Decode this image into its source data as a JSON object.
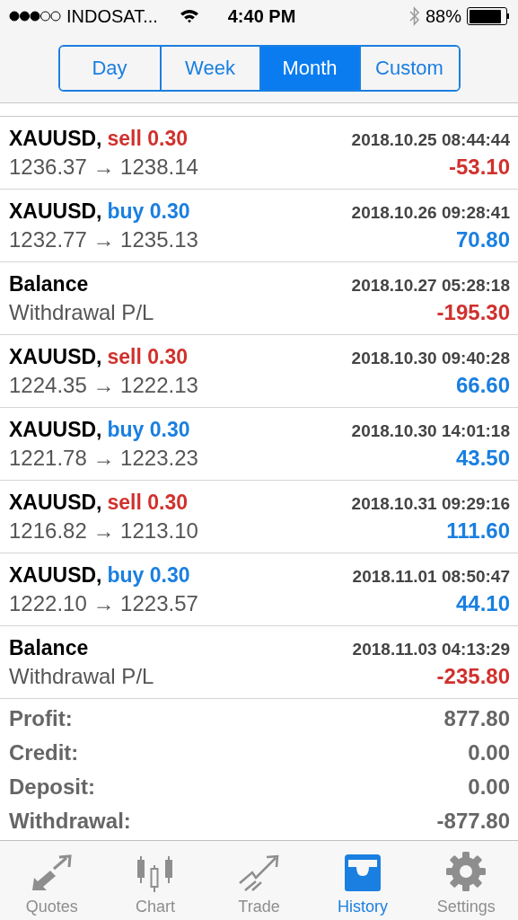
{
  "status_bar": {
    "carrier": "INDOSAT...",
    "time": "4:40 PM",
    "battery": "88%"
  },
  "period_tabs": [
    {
      "label": "Day",
      "selected": false
    },
    {
      "label": "Week",
      "selected": false
    },
    {
      "label": "Month",
      "selected": true
    },
    {
      "label": "Custom",
      "selected": false
    }
  ],
  "deals": [
    {
      "kind": "sell",
      "symbol": "XAUUSD,",
      "order": "sell 0.30",
      "time": "2018.10.25 08:44:44",
      "detail": "1236.37 → 1238.14",
      "amount": "-53.10",
      "negative": true
    },
    {
      "kind": "buy",
      "symbol": "XAUUSD,",
      "order": "buy 0.30",
      "time": "2018.10.26 09:28:41",
      "detail": "1232.77 → 1235.13",
      "amount": "70.80",
      "negative": false
    },
    {
      "kind": "balance",
      "symbol": "Balance",
      "time": "2018.10.27 05:28:18",
      "detail": "Withdrawal P/L",
      "amount": "-195.30",
      "negative": true
    },
    {
      "kind": "sell",
      "symbol": "XAUUSD,",
      "order": "sell 0.30",
      "time": "2018.10.30 09:40:28",
      "detail": "1224.35 → 1222.13",
      "amount": "66.60",
      "negative": false
    },
    {
      "kind": "buy",
      "symbol": "XAUUSD,",
      "order": "buy 0.30",
      "time": "2018.10.30 14:01:18",
      "detail": "1221.78 → 1223.23",
      "amount": "43.50",
      "negative": false
    },
    {
      "kind": "sell",
      "symbol": "XAUUSD,",
      "order": "sell 0.30",
      "time": "2018.10.31 09:29:16",
      "detail": "1216.82 → 1213.10",
      "amount": "111.60",
      "negative": false
    },
    {
      "kind": "buy",
      "symbol": "XAUUSD,",
      "order": "buy 0.30",
      "time": "2018.11.01 08:50:47",
      "detail": "1222.10 → 1223.57",
      "amount": "44.10",
      "negative": false
    },
    {
      "kind": "balance",
      "symbol": "Balance",
      "time": "2018.11.03 04:13:29",
      "detail": "Withdrawal P/L",
      "amount": "-235.80",
      "negative": true
    }
  ],
  "summary": [
    {
      "label": "Profit:",
      "value": "877.80"
    },
    {
      "label": "Credit:",
      "value": "0.00"
    },
    {
      "label": "Deposit:",
      "value": "0.00"
    },
    {
      "label": "Withdrawal:",
      "value": "-877.80"
    }
  ],
  "tab_bar": [
    {
      "kind": "quotes",
      "label": "Quotes",
      "selected": false
    },
    {
      "kind": "chart",
      "label": "Chart",
      "selected": false
    },
    {
      "kind": "trade",
      "label": "Trade",
      "selected": false
    },
    {
      "kind": "history",
      "label": "History",
      "selected": true
    },
    {
      "kind": "settings",
      "label": "Settings",
      "selected": false
    }
  ]
}
